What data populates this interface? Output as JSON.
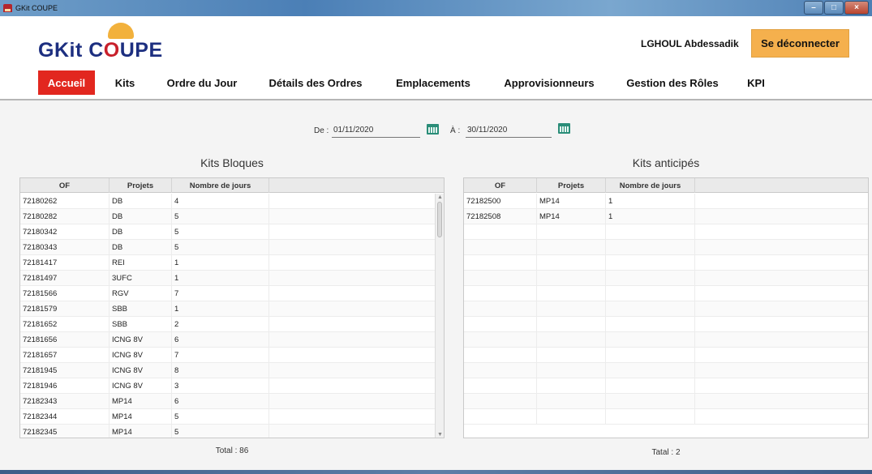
{
  "window": {
    "title": "GKit COUPE"
  },
  "header": {
    "logo_text_left": "GKit C",
    "logo_text_gear": "O",
    "logo_text_right": "UPE",
    "user_name": "LGHOUL Abdessadik",
    "logout_label": "Se déconnecter"
  },
  "nav": {
    "items": [
      {
        "label": "Accueil",
        "active": true
      },
      {
        "label": "Kits"
      },
      {
        "label": "Ordre du Jour"
      },
      {
        "label": "Détails des Ordres"
      },
      {
        "label": "Emplacements"
      },
      {
        "label": "Approvisionneurs"
      },
      {
        "label": "Gestion des Rôles"
      },
      {
        "label": "KPI"
      }
    ]
  },
  "filters": {
    "from_label": "De :",
    "from_value": "01/11/2020",
    "to_label": "À :",
    "to_value": "30/11/2020"
  },
  "kits_bloques": {
    "title": "Kits Bloques",
    "columns": [
      "OF",
      "Projets",
      "Nombre de jours"
    ],
    "rows": [
      [
        "72180262",
        "DB",
        "4"
      ],
      [
        "72180282",
        "DB",
        "5"
      ],
      [
        "72180342",
        "DB",
        "5"
      ],
      [
        "72180343",
        "DB",
        "5"
      ],
      [
        "72181417",
        "REI",
        "1"
      ],
      [
        "72181497",
        "3UFC",
        "1"
      ],
      [
        "72181566",
        "RGV",
        "7"
      ],
      [
        "72181579",
        "SBB",
        "1"
      ],
      [
        "72181652",
        "SBB",
        "2"
      ],
      [
        "72181656",
        "ICNG 8V",
        "6"
      ],
      [
        "72181657",
        "ICNG 8V",
        "7"
      ],
      [
        "72181945",
        "ICNG 8V",
        "8"
      ],
      [
        "72181946",
        "ICNG 8V",
        "3"
      ],
      [
        "72182343",
        "MP14",
        "6"
      ],
      [
        "72182344",
        "MP14",
        "5"
      ],
      [
        "72182345",
        "MP14",
        "5"
      ]
    ],
    "total": "Total : 86"
  },
  "kits_anticipes": {
    "title": "Kits anticipés",
    "columns": [
      "OF",
      "Projets",
      "Nombre de jours"
    ],
    "rows": [
      [
        "72182500",
        "MP14",
        "1"
      ],
      [
        "72182508",
        "MP14",
        "1"
      ]
    ],
    "empty_rows": 13,
    "total": "Tatal : 2"
  },
  "colors": {
    "accent_red": "#e2271f",
    "logout_orange": "#f5b04d",
    "logo_blue": "#1d2f80",
    "calendar_green": "#2a8d78"
  }
}
